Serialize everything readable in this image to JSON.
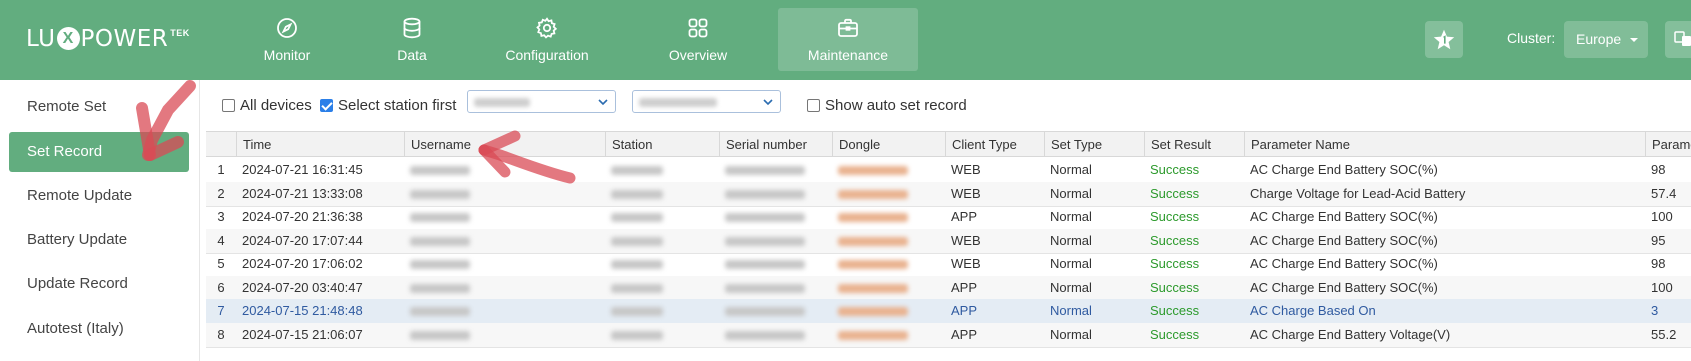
{
  "app": {
    "logo": {
      "left": "LU",
      "mark": "X",
      "right": "POWER",
      "superscript": "TEK"
    }
  },
  "nav": {
    "items": [
      {
        "label": "Monitor",
        "icon": "compass-icon"
      },
      {
        "label": "Data",
        "icon": "database-icon"
      },
      {
        "label": "Configuration",
        "icon": "gear-icon"
      },
      {
        "label": "Overview",
        "icon": "grid-icon"
      },
      {
        "label": "Maintenance",
        "icon": "briefcase-icon",
        "active": true
      }
    ],
    "cluster_label": "Cluster:",
    "cluster_value": "Europe"
  },
  "sidebar": {
    "items": [
      {
        "label": "Remote Set"
      },
      {
        "label": "Set Record",
        "active": true
      },
      {
        "label": "Remote Update"
      },
      {
        "label": "Battery Update"
      },
      {
        "label": "Update Record"
      },
      {
        "label": "Autotest (Italy)"
      }
    ]
  },
  "filters": {
    "all_devices_label": "All devices",
    "all_devices_checked": false,
    "select_station_label": "Select station first",
    "select_station_checked": true,
    "show_auto_label": "Show auto set record",
    "show_auto_checked": false
  },
  "table": {
    "headers": {
      "time": "Time",
      "username": "Username",
      "station": "Station",
      "serial": "Serial number",
      "dongle": "Dongle",
      "client_type": "Client Type",
      "set_type": "Set Type",
      "set_result": "Set Result",
      "parameter_name": "Parameter Name",
      "parameter_value": "Parame"
    },
    "rows": [
      {
        "index": "1",
        "time": "2024-07-21 16:31:45",
        "client_type": "WEB",
        "set_type": "Normal",
        "set_result": "Success",
        "parameter_name": "AC Charge End Battery SOC(%)",
        "value": "98"
      },
      {
        "index": "2",
        "time": "2024-07-21 13:33:08",
        "client_type": "WEB",
        "set_type": "Normal",
        "set_result": "Success",
        "parameter_name": "Charge Voltage for Lead-Acid Battery",
        "value": "57.4"
      },
      {
        "index": "3",
        "time": "2024-07-20 21:36:38",
        "client_type": "APP",
        "set_type": "Normal",
        "set_result": "Success",
        "parameter_name": "AC Charge End Battery SOC(%)",
        "value": "100"
      },
      {
        "index": "4",
        "time": "2024-07-20 17:07:44",
        "client_type": "WEB",
        "set_type": "Normal",
        "set_result": "Success",
        "parameter_name": "AC Charge End Battery SOC(%)",
        "value": "95"
      },
      {
        "index": "5",
        "time": "2024-07-20 17:06:02",
        "client_type": "WEB",
        "set_type": "Normal",
        "set_result": "Success",
        "parameter_name": "AC Charge End Battery SOC(%)",
        "value": "98"
      },
      {
        "index": "6",
        "time": "2024-07-20 03:40:47",
        "client_type": "APP",
        "set_type": "Normal",
        "set_result": "Success",
        "parameter_name": "AC Charge End Battery SOC(%)",
        "value": "100"
      },
      {
        "index": "7",
        "time": "2024-07-15 21:48:48",
        "client_type": "APP",
        "set_type": "Normal",
        "set_result": "Success",
        "parameter_name": "AC Charge Based On",
        "value": "3"
      },
      {
        "index": "8",
        "time": "2024-07-15 21:06:07",
        "client_type": "APP",
        "set_type": "Normal",
        "set_result": "Success",
        "parameter_name": "AC Charge End Battery Voltage(V)",
        "value": "55.2"
      }
    ]
  },
  "colors": {
    "brand_green": "#62ad7f",
    "success_green": "#2c9a2c",
    "annotation_red": "#d94b55"
  }
}
